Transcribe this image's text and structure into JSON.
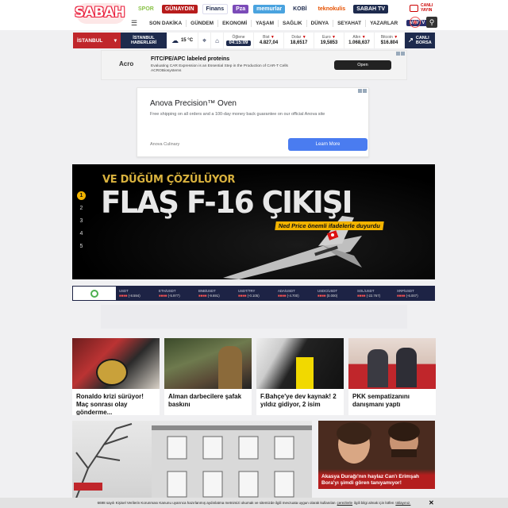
{
  "header": {
    "logo": "SABAH",
    "brands": [
      "SPOR",
      "GÜNAYDIN",
      "Finans",
      "Pza",
      "memurlar",
      "KOBİ",
      "teknokulis",
      "SABAH TV"
    ],
    "canli_yayin": "CANLI YAYIN",
    "nav": [
      "SON DAKİKA",
      "GÜNDEM",
      "EKONOMİ",
      "YAŞAM",
      "SAĞLIK",
      "DÜNYA",
      "SEYAHAT",
      "YAZARLAR"
    ],
    "vavtv": "VAVTV"
  },
  "ticker": {
    "city": "İSTANBUL",
    "city_news": "İSTANBUL HABERLERİ",
    "weather": "15 °C",
    "time_label": "Öğlene",
    "time": "04:15:09",
    "items": [
      {
        "label": "Bist",
        "value": "4.827,04"
      },
      {
        "label": "Dolar",
        "value": "18,6517"
      },
      {
        "label": "Euro",
        "value": "19,5853"
      },
      {
        "label": "Altın",
        "value": "1.068,637"
      },
      {
        "label": "Bitcoin",
        "value": "$16.804"
      }
    ],
    "canli_borsa": "CANLI BORSA"
  },
  "ad1": {
    "brand": "Acro",
    "title": "FITC/PE/APC labeled proteins",
    "desc": "Evaluating CAR Expression is an Essential Step in the Production of CAR-T Cells ACROBiosystems",
    "button": "Open"
  },
  "ad2": {
    "title": "Anova Precision™ Oven",
    "desc": "Free shipping on all orders and a 100-day money back guarantee on our official Anova site",
    "advertiser": "Anova Culinary",
    "button": "Learn More"
  },
  "hero": {
    "supertitle": "VE DÜĞÜM ÇÖZÜLÜYOR",
    "title": "FLAŞ F-16 ÇIKIŞI",
    "subtitle": "Ned Price önemli ifadelerle duyurdu",
    "pages": [
      "1",
      "2",
      "3",
      "4",
      "5"
    ],
    "active_page": 1
  },
  "crypto": [
    {
      "pair": "USDT",
      "change": "(-8.594)"
    },
    {
      "pair": "ETH/USDT",
      "change": "(-5.977)"
    },
    {
      "pair": "BNB/USDT",
      "change": "(-9.691)"
    },
    {
      "pair": "USDT/TRY",
      "change": "(-0.105)"
    },
    {
      "pair": "ADA/USDT",
      "change": "(-4.700)"
    },
    {
      "pair": "USDC/USDT",
      "change": "(0.000)"
    },
    {
      "pair": "SOL/USDT",
      "change": "(-22.767)"
    },
    {
      "pair": "XRP/USDT",
      "change": "(-6.007)"
    }
  ],
  "cards": [
    {
      "title": "Ronaldo krizi sürüyor! Maç sonrası olay gönderme..."
    },
    {
      "title": "Alman darbecilere şafak baskını"
    },
    {
      "title": "F.Bahçe'ye dev kaynak! 2 yıldız gidiyor, 2 isim"
    },
    {
      "title": "PKK sempatizanını danışmanı yaptı"
    }
  ],
  "side_story": {
    "title": "Akasya Durağı'nın haylaz Can'ı Erimşah Bora'yı şimdi gören tanıyamıyor!"
  },
  "cookie": {
    "text": "6698 sayılı Kişisel Verilerin Korunması Kanunu uyarınca hazırlanmış aydınlatma metnimizi okumak ve sitemizde ilgili mevzuata uygun olarak kullanılan",
    "link1": "çerezlerle",
    "mid": "ilgili bilgi almak için lütfen",
    "link2": "tıklayınız."
  }
}
